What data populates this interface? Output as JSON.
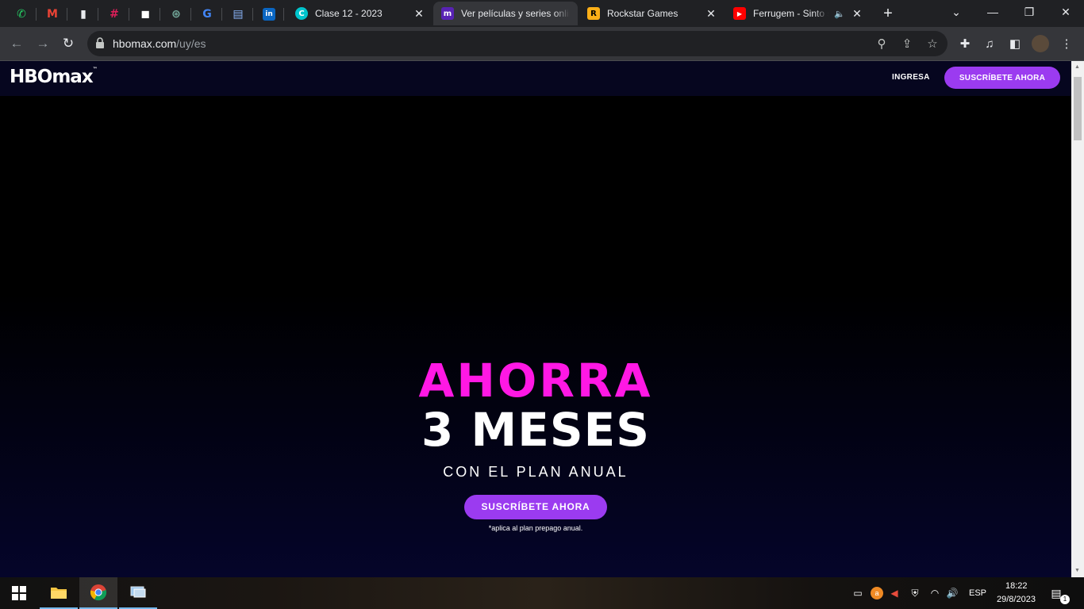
{
  "browser": {
    "pinned_tabs": [
      {
        "icon": "whatsapp-icon",
        "color": "#25d366",
        "glyph": "✆"
      },
      {
        "icon": "gmail-icon",
        "color": "#ea4335",
        "glyph": "M"
      },
      {
        "icon": "bookmark-app-icon",
        "color": "#e8eaed",
        "glyph": "▮"
      },
      {
        "icon": "slack-icon",
        "color": "#e01e5a",
        "glyph": "#"
      },
      {
        "icon": "coder-icon",
        "color": "#ffffff",
        "glyph": "◼"
      },
      {
        "icon": "chatgpt-icon",
        "color": "#74aa9c",
        "glyph": "⊛"
      },
      {
        "icon": "google-icon",
        "color": "#4285f4",
        "glyph": "G"
      },
      {
        "icon": "docs-icon",
        "color": "#8ab4f8",
        "glyph": "▤"
      },
      {
        "icon": "linkedin-icon",
        "color": "#0a66c2",
        "glyph": "in"
      }
    ],
    "tabs": [
      {
        "title": "Clase 12 - 2023",
        "icon": "canva-icon",
        "icon_color": "#00c4cc",
        "icon_glyph": "C"
      },
      {
        "title": "Ver películas y series online",
        "icon": "hbomax-tab-icon",
        "icon_color": "#5822b4",
        "icon_glyph": "m"
      },
      {
        "title": "Rockstar Games",
        "icon": "rockstar-icon",
        "icon_color": "#fcaf17",
        "icon_glyph": "R"
      },
      {
        "title": "Ferrugem - Sinto saudade",
        "icon": "youtube-icon",
        "icon_color": "#ff0000",
        "icon_glyph": "▶"
      }
    ],
    "url_host": "hbomax.com",
    "url_path": "/uy/es"
  },
  "site": {
    "logo_text": "HBOmax",
    "logo_tm": "™",
    "login": "INGRESA",
    "subscribe_top": "SUSCRÍBETE AHORA"
  },
  "hero": {
    "line1": "AHORRA",
    "line2": "3 MESES",
    "line3": "CON EL PLAN ANUAL",
    "cta": "SUSCRÍBETE AHORA",
    "note": "*aplica al plan prepago anual."
  },
  "colors": {
    "accent_magenta": "#ff18e4",
    "button_purple": "#9b3bf0",
    "header_navy": "#06061f"
  },
  "taskbar": {
    "language": "ESP",
    "time": "18:22",
    "date": "29/8/2023",
    "notifications": "1"
  }
}
